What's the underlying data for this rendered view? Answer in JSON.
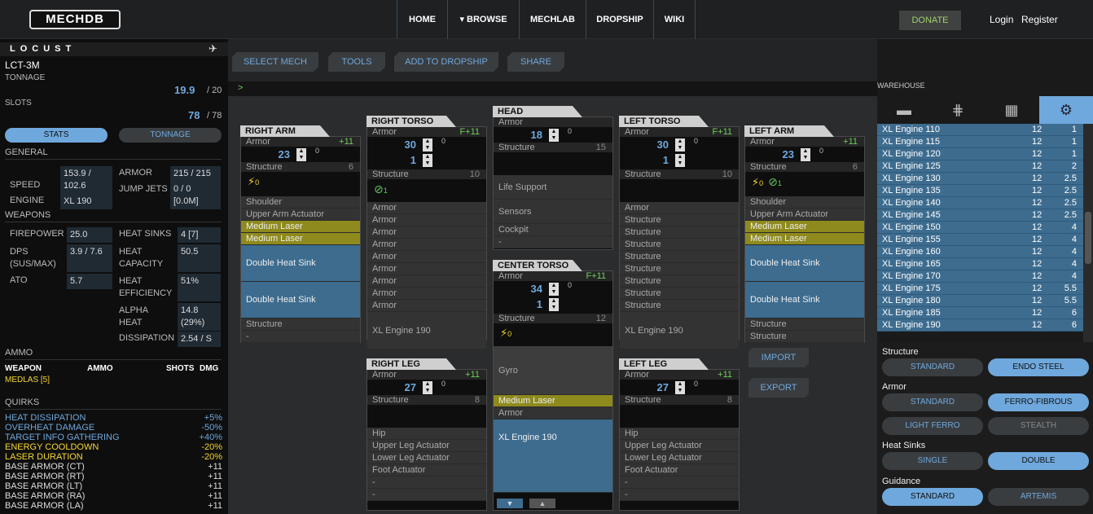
{
  "nav": {
    "logo": "MECHDB",
    "home": "HOME",
    "browse": "BROWSE",
    "mechlab": "MECHLAB",
    "dropship": "DROPSHIP",
    "wiki": "WIKI",
    "donate": "DONATE",
    "login": "Login",
    "register": "Register"
  },
  "mech": {
    "name": "LOCUST",
    "variant": "LCT-3M",
    "tonnage_label": "TONNAGE",
    "tonnage": "19.9",
    "tonnage_max": "/ 20",
    "slots_label": "SLOTS",
    "slots": "78",
    "slots_max": "/ 78",
    "stats_tab": "STATS",
    "tonnage_tab": "TONNAGE"
  },
  "general": {
    "heading": "GENERAL",
    "speed_label": "SPEED",
    "speed": "153.9 / 102.6",
    "engine_label": "ENGINE",
    "engine": "XL 190",
    "armor_label": "ARMOR",
    "armor": "215 / 215",
    "jump_label": "JUMP JETS",
    "jump": "0 / 0 [0.0M]"
  },
  "weapons": {
    "heading": "WEAPONS",
    "firepower_label": "FIREPOWER",
    "firepower": "25.0",
    "dps_label": "DPS (SUS/MAX)",
    "dps": "3.9 / 7.6",
    "ato_label": "ATO",
    "ato": "5.7",
    "hs_label": "HEAT SINKS",
    "hs": "4 [7]",
    "hc_label": "HEAT CAPACITY",
    "hc": "50.5",
    "he_label": "HEAT EFFICIENCY",
    "he": "51%",
    "ah_label": "ALPHA HEAT",
    "ah": "14.8 (29%)",
    "dis_label": "DISSIPATION",
    "dis": "2.54 / S"
  },
  "ammo": {
    "heading": "AMMO",
    "col_weapon": "WEAPON",
    "col_ammo": "AMMO",
    "col_shots": "SHOTS",
    "col_dmg": "DMG",
    "row": "MEDLAS [5]"
  },
  "quirks": {
    "heading": "QUIRKS",
    "items": [
      {
        "name": "HEAT DISSIPATION",
        "value": "+5%",
        "color": "#6fa8dc"
      },
      {
        "name": "OVERHEAT DAMAGE",
        "value": "-50%",
        "color": "#6fa8dc"
      },
      {
        "name": "TARGET INFO GATHERING",
        "value": "+40%",
        "color": "#6fa8dc"
      },
      {
        "name": "ENERGY COOLDOWN",
        "value": "-20%",
        "color": "#f5d733"
      },
      {
        "name": "LASER DURATION",
        "value": "-20%",
        "color": "#f5d733"
      },
      {
        "name": "BASE ARMOR (CT)",
        "value": "+11",
        "color": "#dddddd"
      },
      {
        "name": "BASE ARMOR (RT)",
        "value": "+11",
        "color": "#dddddd"
      },
      {
        "name": "BASE ARMOR (LT)",
        "value": "+11",
        "color": "#dddddd"
      },
      {
        "name": "BASE ARMOR (RA)",
        "value": "+11",
        "color": "#dddddd"
      },
      {
        "name": "BASE ARMOR (LA)",
        "value": "+11",
        "color": "#dddddd"
      }
    ]
  },
  "toolbar": {
    "select": "SELECT MECH",
    "tools": "TOOLS",
    "add": "ADD TO DROPSHIP",
    "share": "SHARE",
    "prompt": ">"
  },
  "parts": {
    "ra": {
      "title": "RIGHT ARM",
      "armor_label": "Armor",
      "bonus": "+11",
      "armor": "23",
      "max": "0",
      "structure_label": "Structure",
      "structure": "6",
      "bolt": "0",
      "slots": [
        {
          "t": "Shoulder",
          "k": "n"
        },
        {
          "t": "Upper Arm Actuator",
          "k": "n"
        },
        {
          "t": "Medium Laser",
          "k": "y"
        },
        {
          "t": "Medium Laser",
          "k": "y"
        },
        {
          "t": "Double Heat Sink",
          "k": "b"
        },
        {
          "t": "Double Heat Sink",
          "k": "b"
        },
        {
          "t": "Structure",
          "k": "n"
        },
        {
          "t": "-",
          "k": "n"
        }
      ]
    },
    "rt": {
      "title": "RIGHT TORSO",
      "armor_label": "Armor",
      "bonus": "F+11",
      "armor": "30",
      "armor2": "1",
      "max": "0",
      "structure_label": "Structure",
      "structure": "10",
      "gyro": "1",
      "slots": [
        {
          "t": "Armor",
          "k": "n"
        },
        {
          "t": "Armor",
          "k": "n"
        },
        {
          "t": "Armor",
          "k": "n"
        },
        {
          "t": "Armor",
          "k": "n"
        },
        {
          "t": "Armor",
          "k": "n"
        },
        {
          "t": "Armor",
          "k": "n"
        },
        {
          "t": "Armor",
          "k": "n"
        },
        {
          "t": "Armor",
          "k": "n"
        },
        {
          "t": "Armor",
          "k": "n"
        }
      ],
      "engine": "XL Engine 190"
    },
    "head": {
      "title": "HEAD",
      "armor_label": "Armor",
      "armor": "18",
      "max": "0",
      "structure_label": "Structure",
      "structure": "15",
      "slots": [
        "Life Support",
        "Sensors",
        "Cockpit",
        "-"
      ]
    },
    "ct": {
      "title": "CENTER TORSO",
      "armor_label": "Armor",
      "bonus": "F+11",
      "armor": "34",
      "armor2": "1",
      "max": "0",
      "structure_label": "Structure",
      "structure": "12",
      "bolt": "0",
      "gyro": "Gyro",
      "laser": "Medium Laser",
      "armor_slot": "Armor",
      "engine": "XL Engine 190"
    },
    "lt": {
      "title": "LEFT TORSO",
      "armor_label": "Armor",
      "bonus": "F+11",
      "armor": "30",
      "armor2": "1",
      "max": "0",
      "structure_label": "Structure",
      "structure": "10",
      "slots": [
        {
          "t": "Armor",
          "k": "n"
        },
        {
          "t": "Structure",
          "k": "n"
        },
        {
          "t": "Structure",
          "k": "n"
        },
        {
          "t": "Structure",
          "k": "n"
        },
        {
          "t": "Structure",
          "k": "n"
        },
        {
          "t": "Structure",
          "k": "n"
        },
        {
          "t": "Structure",
          "k": "n"
        },
        {
          "t": "Structure",
          "k": "n"
        },
        {
          "t": "Structure",
          "k": "n"
        }
      ],
      "engine": "XL Engine 190"
    },
    "la": {
      "title": "LEFT ARM",
      "armor_label": "Armor",
      "bonus": "+11",
      "armor": "23",
      "max": "0",
      "structure_label": "Structure",
      "structure": "6",
      "bolt": "0",
      "gyro": "1",
      "slots": [
        {
          "t": "Shoulder",
          "k": "n"
        },
        {
          "t": "Upper Arm Actuator",
          "k": "n"
        },
        {
          "t": "Medium Laser",
          "k": "y"
        },
        {
          "t": "Medium Laser",
          "k": "y"
        },
        {
          "t": "Double Heat Sink",
          "k": "b"
        },
        {
          "t": "Double Heat Sink",
          "k": "b"
        },
        {
          "t": "Structure",
          "k": "n"
        },
        {
          "t": "Structure",
          "k": "n"
        }
      ]
    },
    "rl": {
      "title": "RIGHT LEG",
      "armor_label": "Armor",
      "bonus": "+11",
      "armor": "27",
      "max": "0",
      "structure_label": "Structure",
      "structure": "8",
      "slots": [
        "Hip",
        "Upper Leg Actuator",
        "Lower Leg Actuator",
        "Foot Actuator",
        "-",
        "-"
      ]
    },
    "ll": {
      "title": "LEFT LEG",
      "armor_label": "Armor",
      "bonus": "+11",
      "armor": "27",
      "max": "0",
      "structure_label": "Structure",
      "structure": "8",
      "slots": [
        "Hip",
        "Upper Leg Actuator",
        "Lower Leg Actuator",
        "Foot Actuator",
        "-",
        "-"
      ]
    }
  },
  "import": "IMPORT",
  "export": "EXPORT",
  "warehouse": {
    "heading": "WAREHOUSE",
    "rows": [
      {
        "n": "XL Engine 110",
        "s": "12",
        "w": "1"
      },
      {
        "n": "XL Engine 115",
        "s": "12",
        "w": "1"
      },
      {
        "n": "XL Engine 120",
        "s": "12",
        "w": "1"
      },
      {
        "n": "XL Engine 125",
        "s": "12",
        "w": "2"
      },
      {
        "n": "XL Engine 130",
        "s": "12",
        "w": "2.5"
      },
      {
        "n": "XL Engine 135",
        "s": "12",
        "w": "2.5"
      },
      {
        "n": "XL Engine 140",
        "s": "12",
        "w": "2.5"
      },
      {
        "n": "XL Engine 145",
        "s": "12",
        "w": "2.5"
      },
      {
        "n": "XL Engine 150",
        "s": "12",
        "w": "4"
      },
      {
        "n": "XL Engine 155",
        "s": "12",
        "w": "4"
      },
      {
        "n": "XL Engine 160",
        "s": "12",
        "w": "4"
      },
      {
        "n": "XL Engine 165",
        "s": "12",
        "w": "4"
      },
      {
        "n": "XL Engine 170",
        "s": "12",
        "w": "4"
      },
      {
        "n": "XL Engine 175",
        "s": "12",
        "w": "5.5"
      },
      {
        "n": "XL Engine 180",
        "s": "12",
        "w": "5.5"
      },
      {
        "n": "XL Engine 185",
        "s": "12",
        "w": "6"
      },
      {
        "n": "XL Engine 190",
        "s": "12",
        "w": "6"
      }
    ]
  },
  "upgrades": {
    "structure": "Structure",
    "standard": "STANDARD",
    "endo": "ENDO STEEL",
    "armor": "Armor",
    "ferro": "FERRO-FIBROUS",
    "light": "LIGHT FERRO",
    "stealth": "STEALTH",
    "heatsinks": "Heat Sinks",
    "single": "SINGLE",
    "double": "DOUBLE",
    "guidance": "Guidance",
    "artemis": "ARTEMIS"
  }
}
